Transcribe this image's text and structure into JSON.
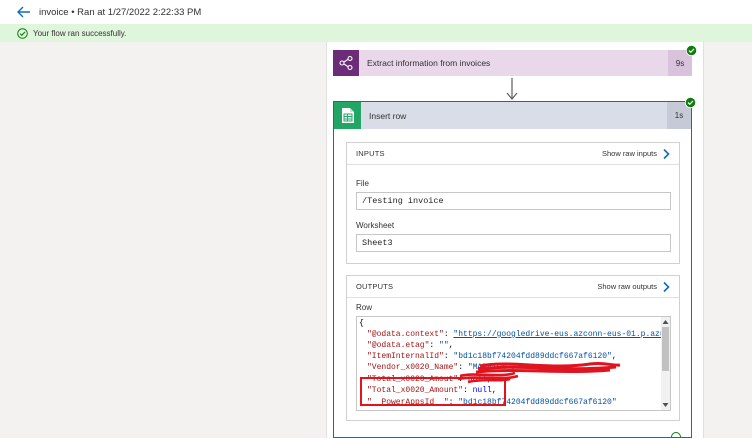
{
  "header": {
    "run_title": "invoice • Ran at 1/27/2022 2:22:33 PM"
  },
  "banner": {
    "message": "Your flow ran successfully."
  },
  "steps": [
    {
      "title": "Extract information from invoices",
      "duration": "9s",
      "icon": "ai-builder-icon",
      "status": "success"
    },
    {
      "title": "Insert row",
      "duration": "1s",
      "icon": "google-sheets-icon",
      "status": "success",
      "inputs": {
        "label": "INPUTS",
        "raw_link": "Show raw inputs",
        "fields": [
          {
            "label": "File",
            "value": "/Testing invoice"
          },
          {
            "label": "Worksheet",
            "value": "Sheet3"
          }
        ]
      },
      "outputs": {
        "label": "OUTPUTS",
        "raw_link": "Show raw outputs",
        "row_label": "Row",
        "json_lines": [
          "{",
          "\"@odata.context\": \"https://googledrive-eus.azconn-eus-01.p.azu",
          "\"@odata.etag\": \"\",",
          "\"ItemInternalId\": \"bd1c18bf74204fdd89ddcf667af6120\",",
          "\"Vendor_x0020_Name\": \"MARVIEW\",",
          "\"Total_x0020_Amout\": null,",
          "\"Total_x0020_Amount\": null,",
          "\"__PowerAppsId__\": \"bd1c18bf74204fdd89ddcf667af6120\""
        ]
      }
    }
  ],
  "colors": {
    "success": "#107c10",
    "accent": "#0f6cbd",
    "ai_builder": "#6b2c78",
    "sheets": "#23a566",
    "annotation": "#e0141e"
  }
}
